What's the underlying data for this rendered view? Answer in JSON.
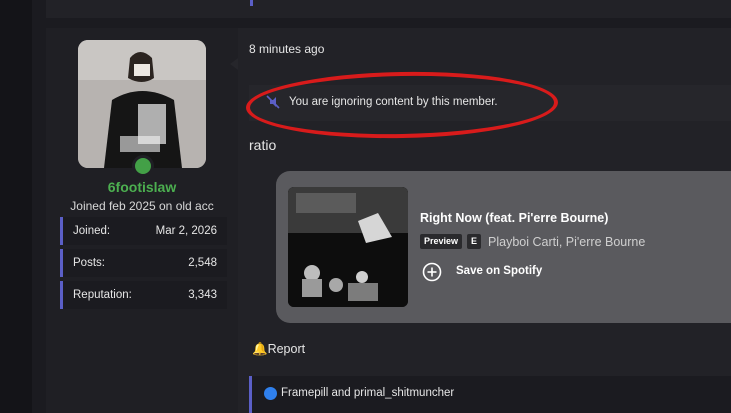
{
  "post": {
    "timestamp": "8 minutes ago",
    "ignore_notice": "You are ignoring content by this member.",
    "message": "ratio",
    "report_label": "Report",
    "reactions_text": "Framepill and primal_shitmuncher"
  },
  "user": {
    "username": "6footislaw",
    "title": "Joined feb 2025 on old acc",
    "online": true,
    "stats": [
      {
        "label": "Joined:",
        "value": "Mar 2, 2026"
      },
      {
        "label": "Posts:",
        "value": "2,548"
      },
      {
        "label": "Reputation:",
        "value": "3,343"
      }
    ]
  },
  "embed": {
    "track_title": "Right Now (feat. Pi'erre Bourne)",
    "preview_badge": "Preview",
    "explicit_badge": "E",
    "artists": "Playboi Carti, Pi'erre Bourne",
    "save_label": "Save on Spotify"
  },
  "colors": {
    "accent": "#5b5fc7",
    "online": "#43a047",
    "username": "#4caf50",
    "highlight": "#d81b1b"
  },
  "icons": {
    "mute": "mute-icon",
    "bell": "bell-icon",
    "like": "like-icon",
    "add": "add-icon"
  }
}
